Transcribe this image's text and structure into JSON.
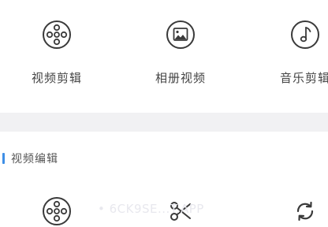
{
  "top_tools": [
    {
      "label": "视频剪辑",
      "icon": "film-reel-icon"
    },
    {
      "label": "相册视频",
      "icon": "photo-album-icon"
    },
    {
      "label": "音乐剪辑",
      "icon": "music-note-icon"
    }
  ],
  "section": {
    "title": "视频编辑",
    "accent_color": "#3f8fe6"
  },
  "bottom_tools": [
    {
      "icon": "film-reel-icon"
    },
    {
      "icon": "scissors-icon"
    },
    {
      "icon": "refresh-icon"
    }
  ],
  "watermark": {
    "text": "• 6CK9SE...T.APP"
  },
  "colors": {
    "icon_stroke": "#333333",
    "background": "#ffffff",
    "band": "#f1f1f3"
  }
}
